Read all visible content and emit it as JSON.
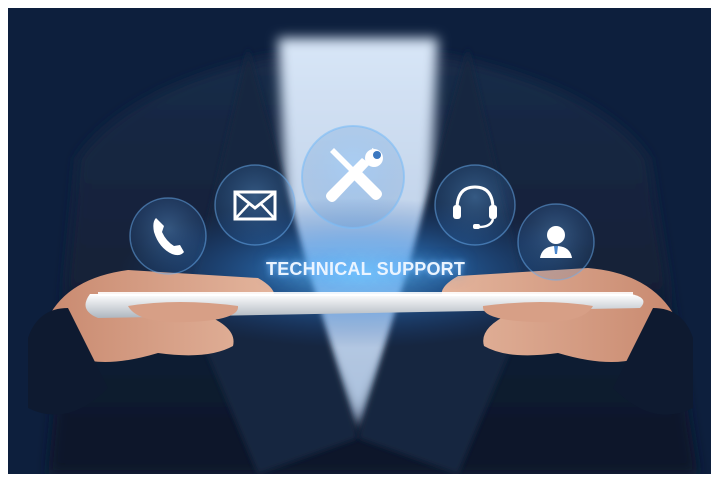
{
  "banner": {
    "label": "TECHNICAL SUPPORT"
  },
  "icons": [
    {
      "name": "phone-icon"
    },
    {
      "name": "mail-icon"
    },
    {
      "name": "tools-icon"
    },
    {
      "name": "headset-icon"
    },
    {
      "name": "person-icon"
    }
  ],
  "colors": {
    "background": "#0f2447",
    "glow": "#5fb3ff",
    "shirt": "#c9d9ef",
    "skin": "#d9a48a",
    "tablet": "#f4f6f8"
  }
}
